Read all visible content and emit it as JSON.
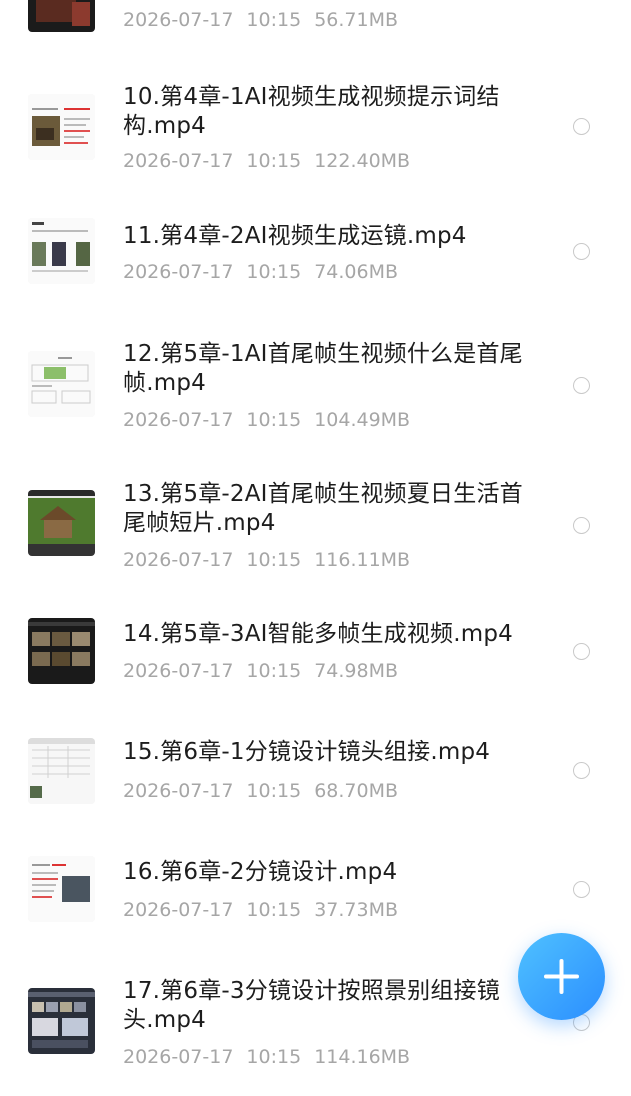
{
  "files": [
    {
      "title": "",
      "date": "2026-07-17",
      "time": "10:15",
      "size": "56.71MB",
      "thumb": "video-frame-dark"
    },
    {
      "title": "10.第4章-1AI视频生成视频提示词结构.mp4",
      "date": "2026-07-17",
      "time": "10:15",
      "size": "122.40MB",
      "thumb": "doc-with-horse-image"
    },
    {
      "title": "11.第4章-2AI视频生成运镜.mp4",
      "date": "2026-07-17",
      "time": "10:15",
      "size": "74.06MB",
      "thumb": "doc-with-three-images"
    },
    {
      "title": "12.第5章-1AI首尾帧生视频什么是首尾帧.mp4",
      "date": "2026-07-17",
      "time": "10:15",
      "size": "104.49MB",
      "thumb": "diagram-with-picture"
    },
    {
      "title": "13.第5章-2AI首尾帧生视频夏日生活首尾帧短片.mp4",
      "date": "2026-07-17",
      "time": "10:15",
      "size": "116.11MB",
      "thumb": "house-scene-editor"
    },
    {
      "title": "14.第5章-3AI智能多帧生成视频.mp4",
      "date": "2026-07-17",
      "time": "10:15",
      "size": "74.98MB",
      "thumb": "dark-frames-editor"
    },
    {
      "title": "15.第6章-1分镜设计镜头组接.mp4",
      "date": "2026-07-17",
      "time": "10:15",
      "size": "68.70MB",
      "thumb": "spreadsheet-doc"
    },
    {
      "title": "16.第6章-2分镜设计.mp4",
      "date": "2026-07-17",
      "time": "10:15",
      "size": "37.73MB",
      "thumb": "doc-red-text-image"
    },
    {
      "title": "17.第6章-3分镜设计按照景别组接镜头.mp4",
      "date": "2026-07-17",
      "time": "10:15",
      "size": "114.16MB",
      "thumb": "storyboard-editor"
    }
  ],
  "fab": {
    "icon": "plus-icon"
  },
  "colors": {
    "title": "#1d1d1d",
    "meta": "#a6a6a6",
    "accent": "#2b8eff"
  }
}
